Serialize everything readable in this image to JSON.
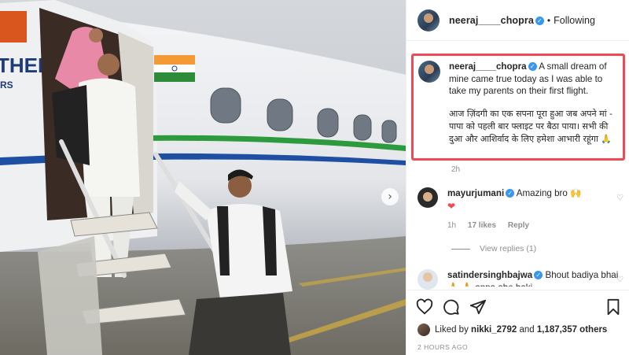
{
  "post": {
    "username": "neeraj____chopra",
    "follow_state": "Following",
    "separator": "•",
    "caption_en": "A small dream of mine came true today as I was able to take my parents on their first flight.",
    "caption_hi": "आज ज़िंदगी का एक सपना पूरा हुआ जब अपने मां - पापा को पहली बार फ्लाइट पर बैठा पाया। सभी की दुआ और आशिर्वाद के लिए हमेशा आभारी रहूंगा 🙏",
    "caption_time": "2h",
    "plane_text": "THER",
    "plane_subtext": "RS",
    "next_icon": "›"
  },
  "comments": [
    {
      "username": "mayurjumani",
      "text": "Amazing bro 🙌",
      "extra": "❤",
      "time": "1h",
      "likes": "17 likes",
      "reply": "Reply",
      "heart": "♡",
      "view_replies": "View replies (1)"
    },
    {
      "username": "satindersinghbajwa",
      "text": "Bhout badiya bhai 🙏 🙏 appa abe baki",
      "heart": "♡"
    }
  ],
  "actions": {
    "like_icon": "heart-icon",
    "comment_icon": "comment-icon",
    "share_icon": "share-icon",
    "save_icon": "bookmark-icon"
  },
  "likes": {
    "prefix": "Liked by ",
    "user": "nikki_2792",
    "middle": " and ",
    "count": "1,187,357 others"
  },
  "posted": "2 HOURS AGO",
  "colors": {
    "verified": "#3897f0",
    "highlight": "#ee4a56",
    "muted": "#8e8e8e"
  }
}
